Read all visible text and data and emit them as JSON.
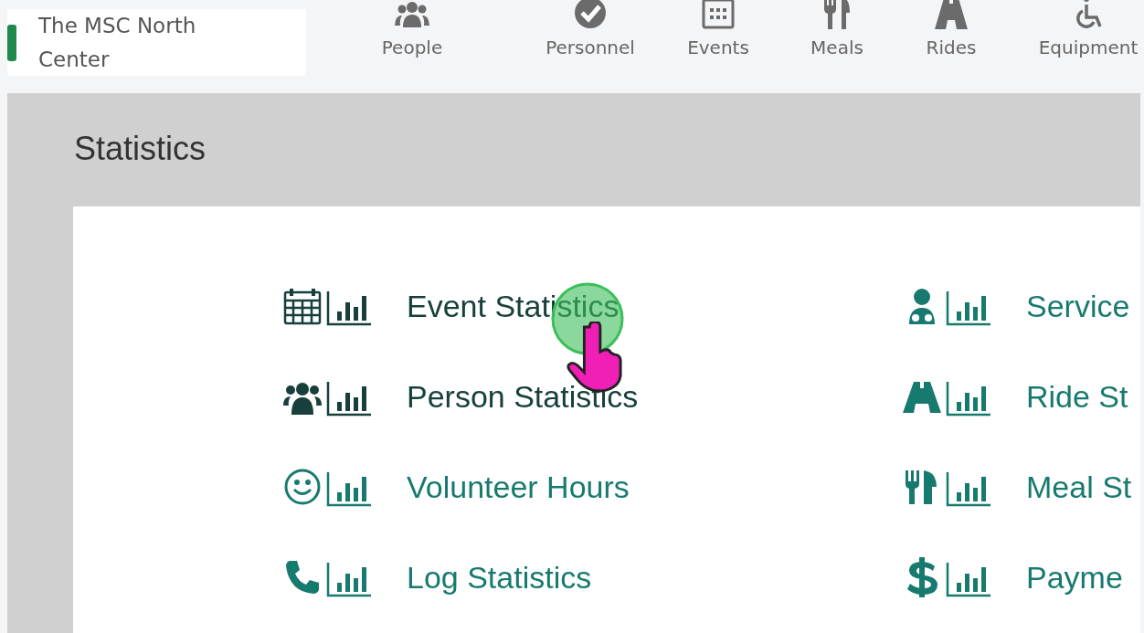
{
  "header": {
    "org_name": "The MSC North Center",
    "nav": [
      {
        "label": "People",
        "kind": "people"
      },
      {
        "label": "Personnel",
        "kind": "check"
      },
      {
        "label": "Events",
        "kind": "calendar"
      },
      {
        "label": "Meals",
        "kind": "utensils"
      },
      {
        "label": "Rides",
        "kind": "road"
      },
      {
        "label": "Equipment",
        "kind": "wheelchair"
      }
    ]
  },
  "page_title": "Statistics",
  "stat_links": [
    {
      "label": "Event Statistics",
      "kind": "calendar",
      "visited": true
    },
    {
      "label": "Service",
      "kind": "doctor",
      "visited": false
    },
    {
      "label": "Person Statistics",
      "kind": "people",
      "visited": true
    },
    {
      "label": "Ride St",
      "kind": "road",
      "visited": false
    },
    {
      "label": "Volunteer Hours",
      "kind": "smile",
      "visited": false
    },
    {
      "label": "Meal St",
      "kind": "utensils",
      "visited": false
    },
    {
      "label": "Log Statistics",
      "kind": "phone",
      "visited": false
    },
    {
      "label": "Payme",
      "kind": "dollar",
      "visited": false
    }
  ]
}
